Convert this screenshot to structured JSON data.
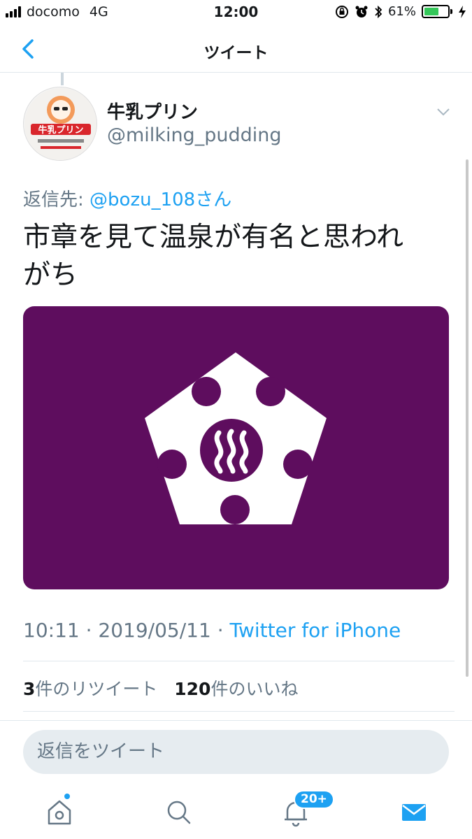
{
  "status_bar": {
    "carrier": "docomo",
    "network": "4G",
    "time": "12:00",
    "battery": "61%",
    "battery_level": 0.61
  },
  "nav": {
    "title": "ツイート",
    "back_icon": "chevron-left-icon"
  },
  "tweet": {
    "display_name": "牛乳プリン",
    "handle": "@milking_pudding",
    "avatar_text": "牛乳プリン",
    "reply_prefix": "返信先: ",
    "reply_mention": "@bozu_108さん",
    "text_line1": "市章を見て温泉が有名と思われ",
    "text_line2": "がち",
    "time": "10:11",
    "date": "2019/05/11",
    "separator": "·",
    "client": "Twitter for iPhone",
    "retweet_count": "3",
    "retweet_label": "件のリツイート",
    "like_count": "120",
    "like_label": "件のいいね"
  },
  "composer": {
    "placeholder": "返信をツイート"
  },
  "tabs": {
    "notifications_badge": "20+",
    "icons": [
      "home-icon",
      "search-icon",
      "bell-icon",
      "mail-icon"
    ]
  },
  "colors": {
    "accent": "#1da1f2",
    "media_background": "#5e0d5e",
    "secondary_text": "#657786"
  }
}
